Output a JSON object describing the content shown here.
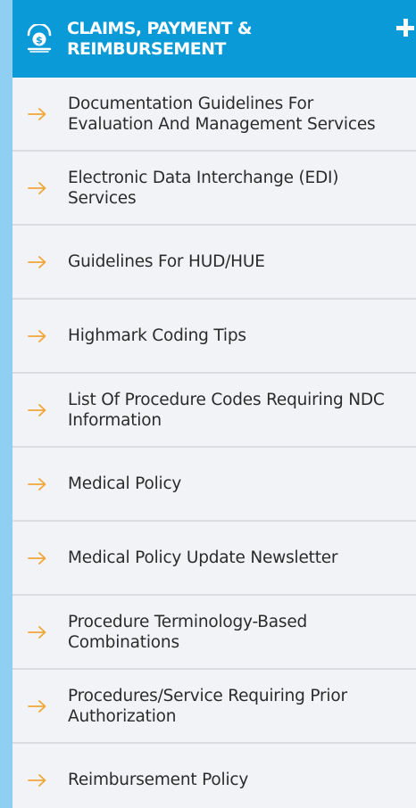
{
  "header": {
    "title": "CLAIMS, PAYMENT & REIMBURSEMENT",
    "icon": "dollar-coin-icon",
    "expand_icon": "plus-icon",
    "background_color": "#0a9ad8"
  },
  "menu": {
    "arrow_color": "#f0a73a",
    "items": [
      {
        "label": "Documentation Guidelines For Evaluation And Management Services"
      },
      {
        "label": "Electronic Data Interchange (EDI) Services"
      },
      {
        "label": "Guidelines For HUD/HUE"
      },
      {
        "label": "Highmark Coding Tips"
      },
      {
        "label": "List Of Procedure Codes Requiring NDC Information"
      },
      {
        "label": "Medical Policy"
      },
      {
        "label": "Medical Policy Update Newsletter"
      },
      {
        "label": "Procedure Terminology-Based Combinations"
      },
      {
        "label": "Procedures/Service Requiring Prior Authorization"
      },
      {
        "label": "Reimbursement Policy"
      }
    ]
  }
}
